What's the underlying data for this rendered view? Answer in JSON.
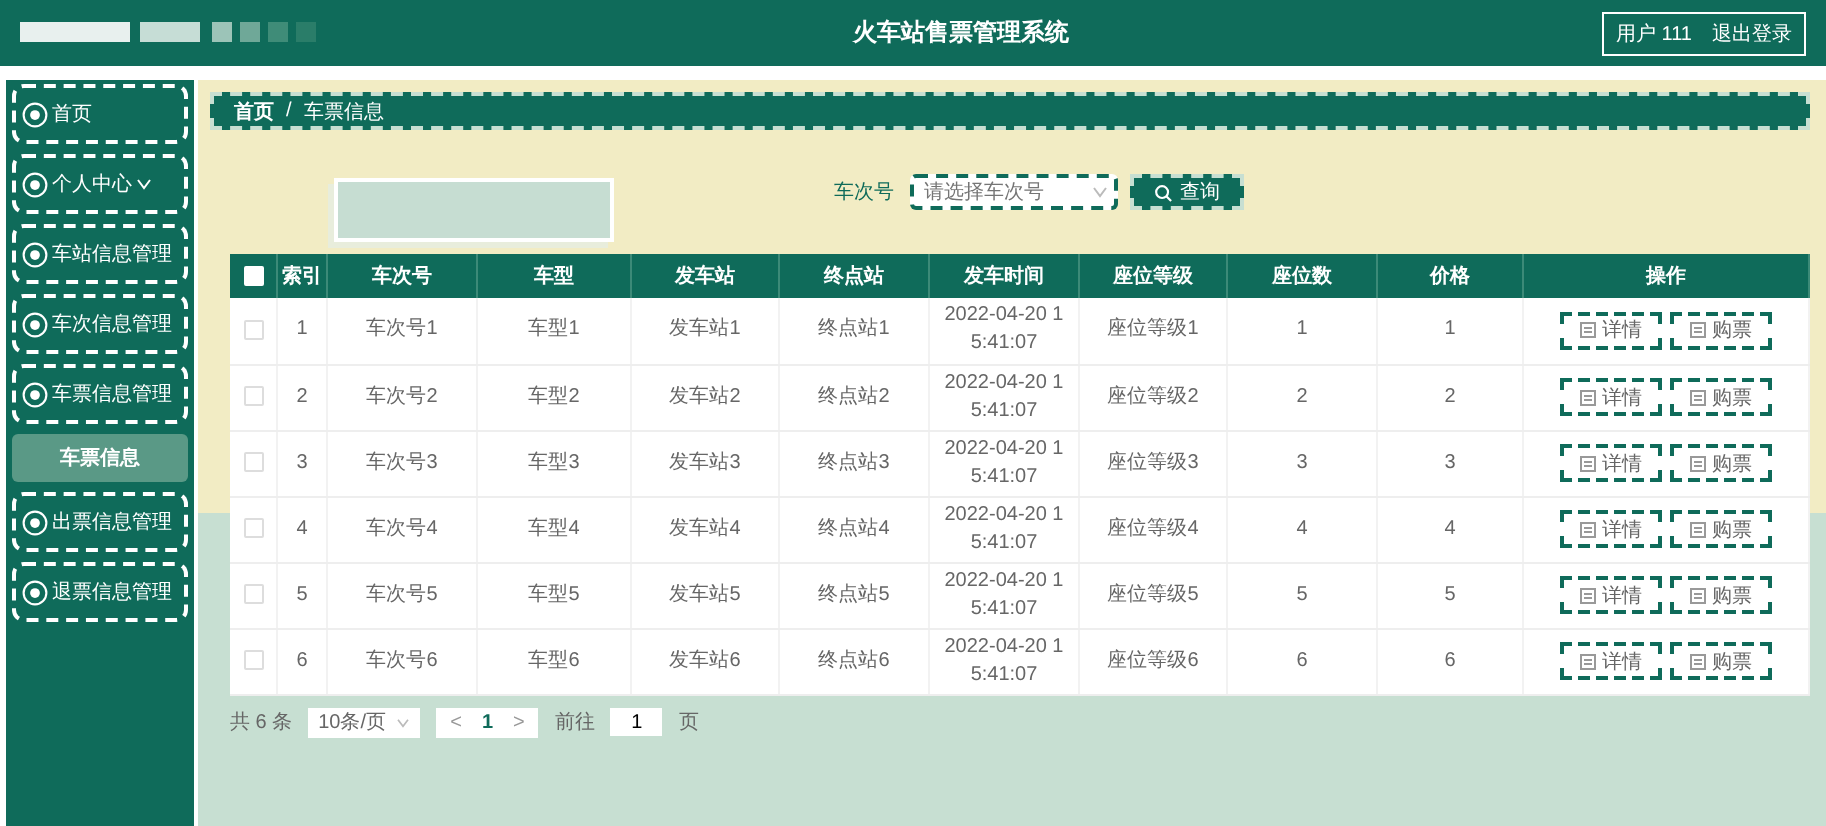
{
  "header": {
    "title": "火车站售票管理系统",
    "user": "用户 111",
    "logout": "退出登录"
  },
  "sidebar": {
    "items": [
      {
        "label": "首页",
        "kind": "link"
      },
      {
        "label": "个人中心",
        "kind": "dropdown",
        "expanded": false
      },
      {
        "label": "车站信息管理",
        "kind": "link"
      },
      {
        "label": "车次信息管理",
        "kind": "link"
      },
      {
        "label": "车票信息管理",
        "kind": "group",
        "expanded": true,
        "children": [
          {
            "label": "车票信息",
            "selected": true
          }
        ]
      },
      {
        "label": "出票信息管理",
        "kind": "link"
      },
      {
        "label": "退票信息管理",
        "kind": "link"
      }
    ]
  },
  "breadcrumb": [
    "首页",
    "/",
    "车票信息"
  ],
  "search": {
    "label": "车次号",
    "placeholder": "请选择车次号",
    "button": "查询"
  },
  "table": {
    "select_all": false,
    "columns": [
      "索引",
      "车次号",
      "车型",
      "发车站",
      "终点站",
      "发车时间",
      "座位等级",
      "座位数",
      "价格",
      "操作"
    ],
    "rows": [
      {
        "checked": false,
        "cells": [
          "1",
          "车次号1",
          "车型1",
          "发车站1",
          "终点站1",
          "2022-04-20 15:41:07",
          "座位等级1",
          "1",
          "1"
        ],
        "actions": [
          "详情",
          "购票"
        ]
      },
      {
        "checked": false,
        "cells": [
          "2",
          "车次号2",
          "车型2",
          "发车站2",
          "终点站2",
          "2022-04-20 15:41:07",
          "座位等级2",
          "2",
          "2"
        ],
        "actions": [
          "详情",
          "购票"
        ]
      },
      {
        "checked": false,
        "cells": [
          "3",
          "车次号3",
          "车型3",
          "发车站3",
          "终点站3",
          "2022-04-20 15:41:07",
          "座位等级3",
          "3",
          "3"
        ],
        "actions": [
          "详情",
          "购票"
        ]
      },
      {
        "checked": false,
        "cells": [
          "4",
          "车次号4",
          "车型4",
          "发车站4",
          "终点站4",
          "2022-04-20 15:41:07",
          "座位等级4",
          "4",
          "4"
        ],
        "actions": [
          "详情",
          "购票"
        ]
      },
      {
        "checked": false,
        "cells": [
          "5",
          "车次号5",
          "车型5",
          "发车站5",
          "终点站5",
          "2022-04-20 15:41:07",
          "座位等级5",
          "5",
          "5"
        ],
        "actions": [
          "详情",
          "购票"
        ]
      },
      {
        "checked": false,
        "cells": [
          "6",
          "车次号6",
          "车型6",
          "发车站6",
          "终点站6",
          "2022-04-20 15:41:07",
          "座位等级6",
          "6",
          "6"
        ],
        "actions": [
          "详情",
          "购票"
        ]
      }
    ]
  },
  "pagination": {
    "total": "共 6 条",
    "page_size": "10条/页",
    "prev": "<",
    "pages": [
      {
        "label": "1",
        "selected": true
      }
    ],
    "next": ">",
    "goto_label": "前往",
    "goto_value": "1",
    "goto_suffix": "页"
  }
}
